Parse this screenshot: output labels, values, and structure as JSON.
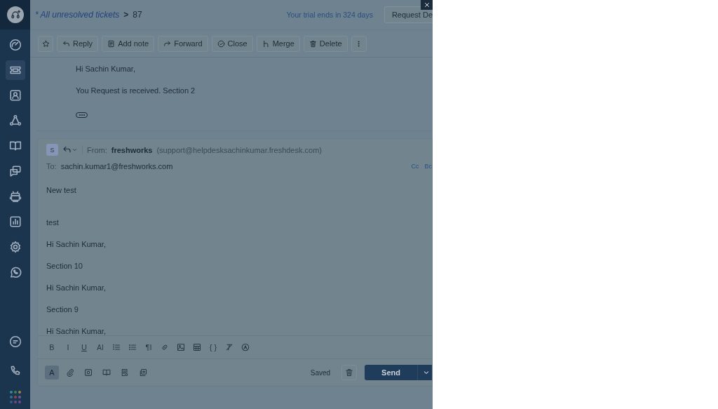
{
  "sidebar": {
    "logo": {
      "kind": "headset"
    },
    "nav_items": [
      {
        "kind": "gauge",
        "selected": false
      },
      {
        "kind": "ticket",
        "selected": true
      },
      {
        "kind": "contact",
        "selected": false
      },
      {
        "kind": "network",
        "selected": false
      },
      {
        "kind": "book",
        "selected": false
      },
      {
        "kind": "chats",
        "selected": false
      },
      {
        "kind": "bot",
        "selected": false
      },
      {
        "kind": "chart",
        "selected": false
      },
      {
        "kind": "gear",
        "selected": false
      },
      {
        "kind": "whatsapp",
        "selected": false
      }
    ],
    "bottom_items": [
      {
        "kind": "chat"
      },
      {
        "kind": "phone"
      },
      {
        "kind": "apps"
      }
    ]
  },
  "header": {
    "breadcrumb": "* All unresolved tickets",
    "separator": ">",
    "ticket_number": "87",
    "trial_notice": "Your trial ends in 324 days",
    "request_button": "Request De"
  },
  "toolbar": {
    "buttons": [
      {
        "kind": "star"
      },
      {
        "kind": "reply",
        "label": "Reply"
      },
      {
        "kind": "note",
        "label": "Add note"
      },
      {
        "kind": "forward",
        "label": "Forward"
      },
      {
        "kind": "close",
        "label": "Close"
      },
      {
        "kind": "merge",
        "label": "Merge"
      },
      {
        "kind": "delete",
        "label": "Delete"
      },
      {
        "kind": "more"
      }
    ]
  },
  "message": {
    "lines": [
      "Hi Sachin Kumar,",
      "You Request is received. Section 2"
    ]
  },
  "reply": {
    "avatar": "S",
    "from_label": "From:",
    "from_name": "freshworks",
    "from_email": "(support@helpdesksachinkumar.freshdesk.com)",
    "to_label": "To:",
    "to": "sachin.kumar1@freshworks.com",
    "cc": "Cc",
    "bcc": "Bc",
    "body": [
      "New test",
      "test",
      "Hi Sachin Kumar,",
      "Section 10",
      "Hi Sachin Kumar,",
      "Section 9",
      "Hi Sachin Kumar,"
    ],
    "format_tools": [
      {
        "kind": "bold",
        "glyph": "B"
      },
      {
        "kind": "italic",
        "glyph": "I"
      },
      {
        "kind": "underline",
        "glyph": "U"
      },
      {
        "kind": "fontsize",
        "glyph": "AI"
      },
      {
        "kind": "numbered"
      },
      {
        "kind": "bulleted"
      },
      {
        "kind": "paragraph",
        "glyph": "¶I"
      },
      {
        "kind": "link"
      },
      {
        "kind": "image"
      },
      {
        "kind": "table"
      },
      {
        "kind": "code",
        "glyph": "{ }"
      },
      {
        "kind": "clear"
      },
      {
        "kind": "auto"
      }
    ],
    "bottom_tools": [
      {
        "kind": "text",
        "glyph": "A",
        "selected": true
      },
      {
        "kind": "attach",
        "selected": false
      },
      {
        "kind": "screenshot",
        "selected": false
      },
      {
        "kind": "book",
        "selected": false
      },
      {
        "kind": "template",
        "selected": false
      },
      {
        "kind": "add",
        "selected": false
      }
    ],
    "status": "Saved",
    "send": "Send"
  }
}
